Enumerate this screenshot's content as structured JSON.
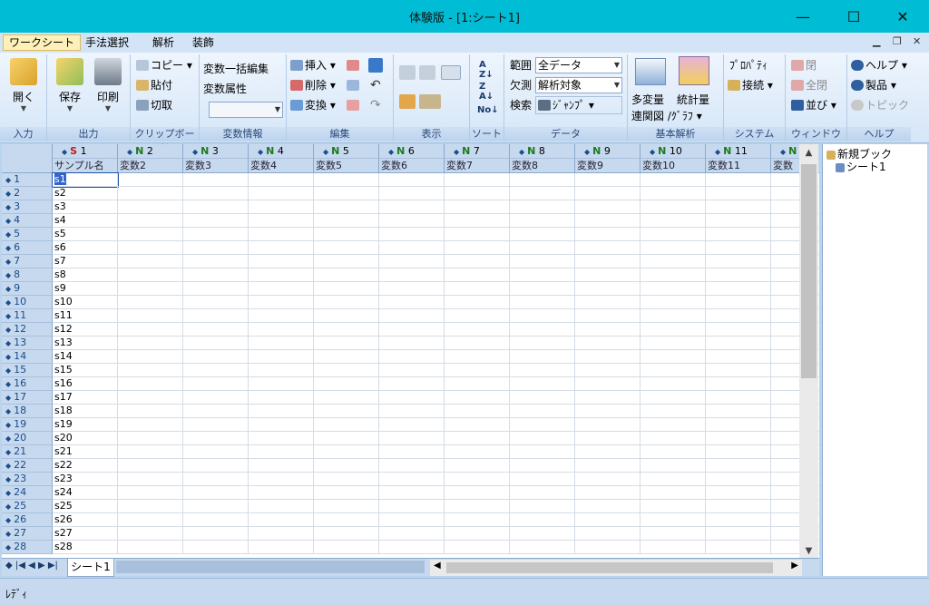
{
  "window": {
    "title": "体験版 - [1:シート1]",
    "min": "—",
    "max": "☐",
    "close": "✕"
  },
  "menu": [
    "ワークシート",
    "手法選択",
    "解析",
    "装飾"
  ],
  "ribbon": {
    "input": {
      "open": "開く",
      "label": "入力"
    },
    "output": {
      "save": "保存",
      "print": "印刷",
      "label": "出力"
    },
    "clipboard": {
      "copy": "コピー",
      "paste": "貼付",
      "cut": "切取",
      "label": "クリップボード"
    },
    "varinfo": {
      "bulk": "変数一括編集",
      "attr": "変数属性",
      "label": "変数情報"
    },
    "edit": {
      "insert": "挿入",
      "delete": "削除",
      "convert": "変換",
      "label": "編集"
    },
    "display": {
      "label": "表示"
    },
    "sort": {
      "label": "ソート"
    },
    "data": {
      "range_label": "範囲",
      "range_value": "全データ",
      "missing_label": "欠測",
      "missing_value": "解析対象",
      "search_label": "検索",
      "jump": "ｼﾞｬﾝﾌﾟ",
      "label": "データ"
    },
    "basic": {
      "multi": "多変量",
      "multi2": "連関図",
      "stat": "統計量",
      "stat2": "/ｸﾞﾗﾌ",
      "label": "基本解析"
    },
    "system": {
      "prop": "ﾌﾟﾛﾊﾟﾃｨ",
      "connect": "接続",
      "label": "システム"
    },
    "window": {
      "close": "閉",
      "closeall": "全閉",
      "arrange": "並び",
      "label": "ウィンドウ"
    },
    "help": {
      "help": "ヘルプ",
      "product": "製品",
      "topic": "トピック",
      "label": "ヘルプ"
    }
  },
  "grid": {
    "columns": [
      {
        "key": "S",
        "num": "1",
        "name": "サンプル名"
      },
      {
        "key": "N",
        "num": "2",
        "name": "変数2"
      },
      {
        "key": "N",
        "num": "3",
        "name": "変数3"
      },
      {
        "key": "N",
        "num": "4",
        "name": "変数4"
      },
      {
        "key": "N",
        "num": "5",
        "name": "変数5"
      },
      {
        "key": "N",
        "num": "6",
        "name": "変数6"
      },
      {
        "key": "N",
        "num": "7",
        "name": "変数7"
      },
      {
        "key": "N",
        "num": "8",
        "name": "変数8"
      },
      {
        "key": "N",
        "num": "9",
        "name": "変数9"
      },
      {
        "key": "N",
        "num": "10",
        "name": "変数10"
      },
      {
        "key": "N",
        "num": "11",
        "name": "変数11"
      },
      {
        "key": "N",
        "num": "",
        "name": "変数"
      }
    ],
    "rows": [
      "s1",
      "s2",
      "s3",
      "s4",
      "s5",
      "s6",
      "s7",
      "s8",
      "s9",
      "s10",
      "s11",
      "s12",
      "s13",
      "s14",
      "s15",
      "s16",
      "s17",
      "s18",
      "s19",
      "s20",
      "s21",
      "s22",
      "s23",
      "s24",
      "s25",
      "s26",
      "s27",
      "s28"
    ]
  },
  "sheet_tab": "シート1",
  "tree": {
    "book": "新規ブック",
    "sheet": "シート1"
  },
  "status": "ﾚﾃﾞｨ",
  "colors": {
    "titlebar": "#00bcd4",
    "ribbon": "#d5e6f8",
    "header": "#c7d9ee"
  }
}
